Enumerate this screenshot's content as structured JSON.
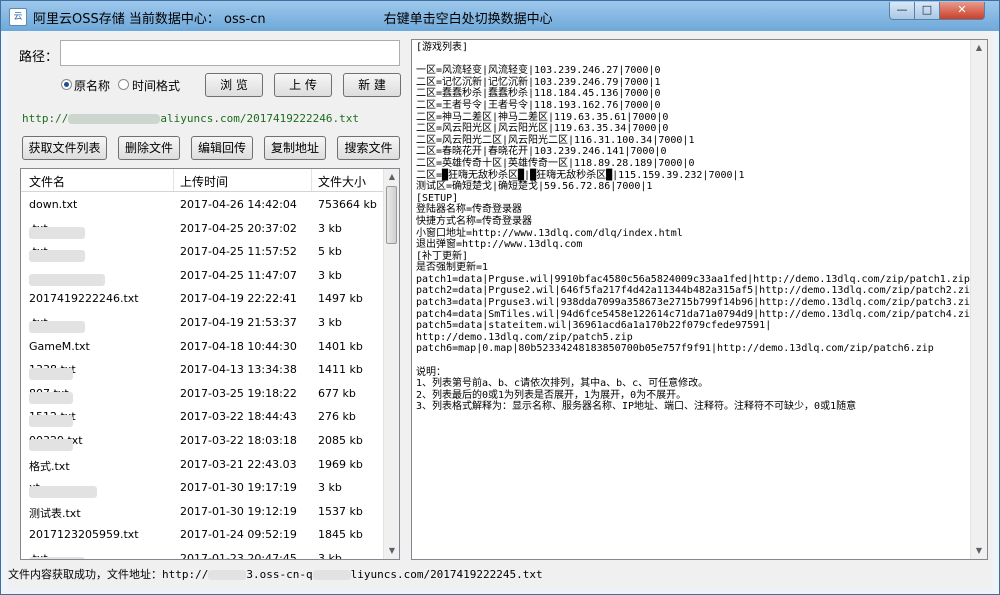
{
  "window": {
    "title": "阿里云OSS存储 当前数据中心： oss-cn",
    "title_suffix": "右键单击空白处切换数据中心",
    "controls": {
      "minimize": "—",
      "maximize": "□",
      "close": "✕"
    }
  },
  "path": {
    "label": "路径：",
    "value": "",
    "placeholder": ""
  },
  "sort": {
    "option1": "原名称",
    "option2": "时间格式",
    "selected": "原名称"
  },
  "toolbar": {
    "browse": "浏 览",
    "upload": "上 传",
    "new": "新 建"
  },
  "url_display": {
    "prefix": "http://",
    "suffix": "aliyuncs.com/2017419222246.txt"
  },
  "actions": {
    "get_list": "获取文件列表",
    "delete": "删除文件",
    "edit_save": "编辑回传",
    "copy_url": "复制地址",
    "search": "搜索文件"
  },
  "file_list": {
    "columns": [
      "文件名",
      "上传时间",
      "文件大小"
    ],
    "rows": [
      {
        "name": "down.txt",
        "time": "2017-04-26 14:42:04",
        "size": "753664 kb"
      },
      {
        "name": ".txt",
        "time": "2017-04-25 20:37:02",
        "size": "3 kb"
      },
      {
        "name": ".txt",
        "time": "2017-04-25 11:57:52",
        "size": "5 kb"
      },
      {
        "name": "",
        "time": "2017-04-25 11:47:07",
        "size": "3 kb"
      },
      {
        "name": "2017419222246.txt",
        "time": "2017-04-19 22:22:41",
        "size": "1497 kb"
      },
      {
        "name": ".txt",
        "time": "2017-04-19 21:53:37",
        "size": "3 kb"
      },
      {
        "name": "GameM.txt",
        "time": "2017-04-18 10:44:30",
        "size": "1401 kb"
      },
      {
        "name": "1338.txt",
        "time": "2017-04-13 13:34:38",
        "size": "1411 kb"
      },
      {
        "name": "807.txt",
        "time": "2017-03-25 19:18:22",
        "size": "677 kb"
      },
      {
        "name": "1512.txt",
        "time": "2017-03-22 18:44:43",
        "size": "276 kb"
      },
      {
        "name": "00329.txt",
        "time": "2017-03-22 18:03:18",
        "size": "2085 kb"
      },
      {
        "name": "格式.txt",
        "time": "2017-03-21 22:43.03",
        "size": "1969 kb"
      },
      {
        "name": "xt",
        "time": "2017-01-30 19:17:19",
        "size": "3 kb"
      },
      {
        "name": "测试表.txt",
        "time": "2017-01-30 19:12:19",
        "size": "1537 kb"
      },
      {
        "name": "2017123205959.txt",
        "time": "2017-01-24 09:52:19",
        "size": "1845 kb"
      },
      {
        "name": ".txt",
        "time": "2017-01-23 20:47:45",
        "size": "3 kb"
      }
    ]
  },
  "editor": {
    "lines": [
      "[游戏列表]",
      "",
      "一区=风流轻变|风流轻变|103.239.246.27|7000|0",
      "二区=记忆沉新|记忆沉新|103.239.246.79|7000|1",
      "二区=蠢蠢秒杀|蠢蠢秒杀|118.184.45.136|7000|0",
      "二区=王者号令|王者号令|118.193.162.76|7000|0",
      "二区=神马二差区|神马二差区|119.63.35.61|7000|0",
      "二区=风云阳光区|风云阳光区|119.63.35.34|7000|0",
      "二区=风云阳光二区|风云阳光二区|116.31.100.34|7000|1",
      "二区=春晓花开|春晓花开|103.239.246.141|7000|0",
      "二区=英雄传奇十区|英雄传奇一区|118.89.28.189|7000|0",
      "二区=█狂嗨无敌秒杀区█|█狂嗨无敌秒杀区█|115.159.39.232|7000|1",
      "测试区=确短楚戈|确短楚戈|59.56.72.86|7000|1",
      "[SETUP]",
      "登陆器名称=传奇登录器",
      "快捷方式名称=传奇登录器",
      "小窗口地址=http://www.13dlq.com/dlq/index.html",
      "退出弹窗=http://www.13dlq.com",
      "[补丁更新]",
      "是否强制更新=1",
      "patch1=data|Prguse.wil|9910bfac4580c56a5824009c33aa1fed|http://demo.13dlq.com/zip/patch1.zip",
      "patch2=data|Prguse2.wil|646f5fa217f4d42a11344b482a315af5|http://demo.13dlq.com/zip/patch2.zip",
      "patch3=data|Prguse3.wil|938dda7099a358673e2715b799f14b96|http://demo.13dlq.com/zip/patch3.zip",
      "patch4=data|SmTiles.wil|94d6fce5458e122614c71da71a0794d9|http://demo.13dlq.com/zip/patch4.zip",
      "patch5=data|stateitem.wil|36961acd6a1a170b22f079cfede97591|",
      "http://demo.13dlq.com/zip/patch5.zip",
      "patch6=map|0.map|80b52334248183850700b05e757f9f91|http://demo.13dlq.com/zip/patch6.zip",
      "",
      "说明：",
      "1、列表第号前a、b、c请依次排列，其中a、b、c、可任意修改。",
      "2、列表最后的0或1为列表是否展开，1为展开，0为不展开。",
      "3、列表格式解释为：显示名称、服务器名称、IP地址、端口、注释符。注释符不可缺少，0或1随意"
    ]
  },
  "status": {
    "label": "文件内容获取成功，文件地址：",
    "url_prefix": "http://",
    "url_mid": "3.oss-cn-q",
    "url_suffix": "liyuncs.com/2017419222245.txt"
  }
}
